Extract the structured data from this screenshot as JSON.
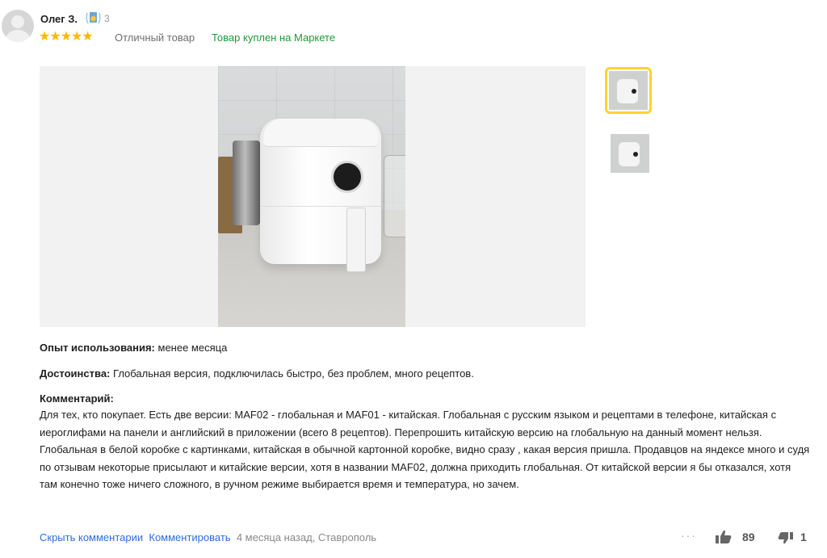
{
  "review": {
    "author": "Олег З.",
    "badge_count": "3",
    "stars": "★★★★★",
    "rating": 5,
    "verdict": "Отличный товар",
    "bought_label": "Товар куплен на Маркете",
    "usage_label": "Опыт использования:",
    "usage_value": "менее месяца",
    "pros_label": "Достоинства:",
    "pros_value": "Глобальная версия, подключилась быстро, без проблем, много рецептов.",
    "comment_label": "Комментарий:",
    "comment_text": "Для тех, кто покупает. Есть две версии: MAF02 - глобальная и MAF01 - китайская. Глобальная с русским языком и рецептами в телефоне, китайская с иероглифами на панели и английский в приложении (всего 8 рецептов). Перепрошить китайскую версию на глобальную на данный момент нельзя. Глобальная в белой коробке с картинками, китайская в обычной картонной коробке, видно сразу , какая версия пришла. Продавцов на яндексе много и судя по отзывам некоторые присылают и китайские версии, хотя в названии MAF02, должна приходить глобальная. От китайской версии я бы отказался, хотя там конечно тоже ничего сложного, в ручном режиме выбирается время и температура, но зачем."
  },
  "footer": {
    "hide_comments": "Скрыть комментарии",
    "comment_action": "Комментировать",
    "meta": "4 месяца назад, Ставрополь",
    "more": "···",
    "likes": "89",
    "dislikes": "1"
  },
  "colors": {
    "star": "#ffb800",
    "bought_green": "#1a9c3a",
    "link_blue": "#2b6ee0",
    "selected_thumb": "#fed42b"
  },
  "icons": {
    "badge": "medal-badge-icon",
    "like": "thumbs-up-icon",
    "dislike": "thumbs-down-icon"
  }
}
